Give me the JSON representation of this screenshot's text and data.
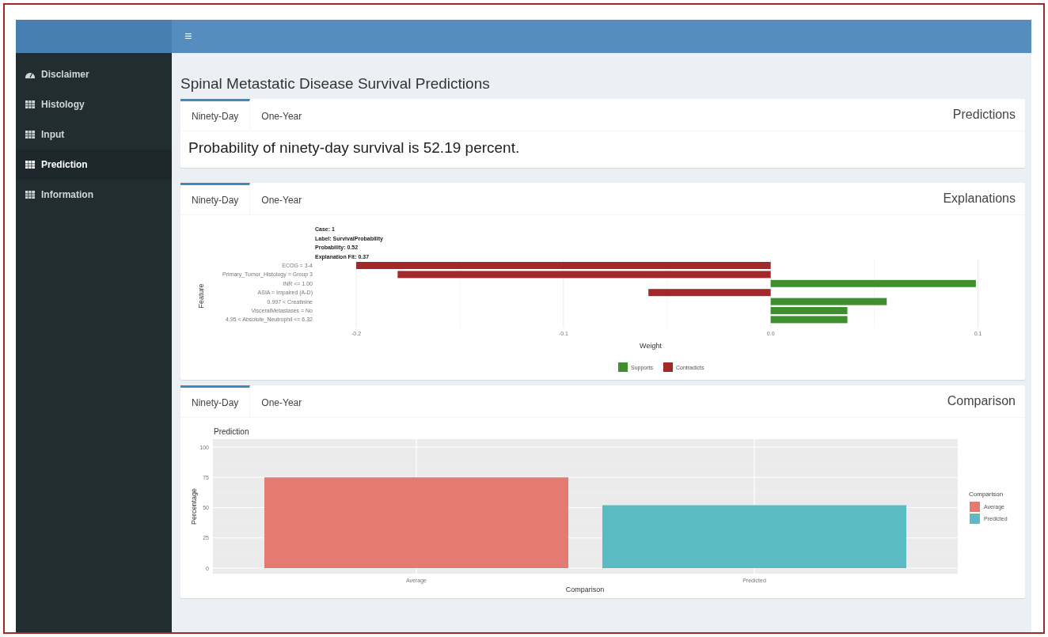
{
  "header": {
    "menu_icon": "≡"
  },
  "sidebar": {
    "items": [
      {
        "label": "Disclaimer",
        "kind": "dashboard",
        "selected": false
      },
      {
        "label": "Histology",
        "kind": "table",
        "selected": false
      },
      {
        "label": "Input",
        "kind": "table",
        "selected": false
      },
      {
        "label": "Prediction",
        "kind": "table",
        "selected": true
      },
      {
        "label": "Information",
        "kind": "table",
        "selected": false
      }
    ]
  },
  "page_title": "Spinal Metastatic Disease Survival Predictions",
  "cards": [
    {
      "title": "Predictions",
      "kind": "text",
      "tabs": [
        {
          "label": "Ninety-Day",
          "selected": true
        },
        {
          "label": "One-Year",
          "selected": false
        }
      ],
      "text": "Probability of ninety-day survival is 52.19 percent."
    },
    {
      "title": "Explanations",
      "kind": "explanation",
      "tabs": [
        {
          "label": "Ninety-Day",
          "selected": true
        },
        {
          "label": "One-Year",
          "selected": false
        }
      ],
      "notes": [
        "Case: 1",
        "Label: SurvivalProbability",
        "Probability: 0.52",
        "Explanation Fit: 0.37"
      ],
      "chart_data": {
        "type": "bar",
        "orientation": "horizontal",
        "xlabel": "Weight",
        "ylabel": "Feature",
        "categories": [
          "ECOG = 3-4",
          "Primary_Tumor_Histology = Group 3",
          "INR <= 1.00",
          "ASIA = Impaired (A-D)",
          "0.997 < Creatinine",
          "VisceralMetastases = No",
          "4.95 < Absolute_Neutrophil <= 6.32"
        ],
        "series": [
          {
            "name": "Supports",
            "color": "#3f8f2f",
            "values": [
              null,
              null,
              0.099,
              null,
              0.056,
              0.037,
              0.037
            ]
          },
          {
            "name": "Contradicts",
            "color": "#a3282a",
            "values": [
              -0.2,
              -0.18,
              null,
              -0.059,
              null,
              null,
              null
            ]
          }
        ],
        "xticks": [
          {
            "value": -0.2,
            "label": "-0.2"
          },
          {
            "value": -0.1,
            "label": "-0.1"
          },
          {
            "value": 0,
            "label": "0.0"
          },
          {
            "value": 0.1,
            "label": "0.1"
          }
        ],
        "xlim": [
          -0.2,
          0.1
        ],
        "grid": true,
        "legend": true
      }
    },
    {
      "title": "Comparison",
      "kind": "comparison",
      "tabs": [
        {
          "label": "Ninety-Day",
          "selected": true
        },
        {
          "label": "One-Year",
          "selected": false
        }
      ],
      "chart_data": {
        "type": "bar",
        "title": "Prediction",
        "xlabel": "Comparison",
        "ylabel": "Percentage",
        "categories": [
          "Average",
          "Predicted"
        ],
        "series": [
          {
            "name": "Average",
            "color": "#e47b73",
            "values": [
              75,
              null
            ]
          },
          {
            "name": "Predicted",
            "color": "#5bbbc3",
            "values": [
              null,
              52
            ]
          }
        ],
        "legend": {
          "title": "Comparison"
        },
        "grid": true,
        "yticks": [
          0,
          25,
          50,
          75,
          100
        ],
        "ylim": [
          0,
          100
        ]
      }
    }
  ]
}
